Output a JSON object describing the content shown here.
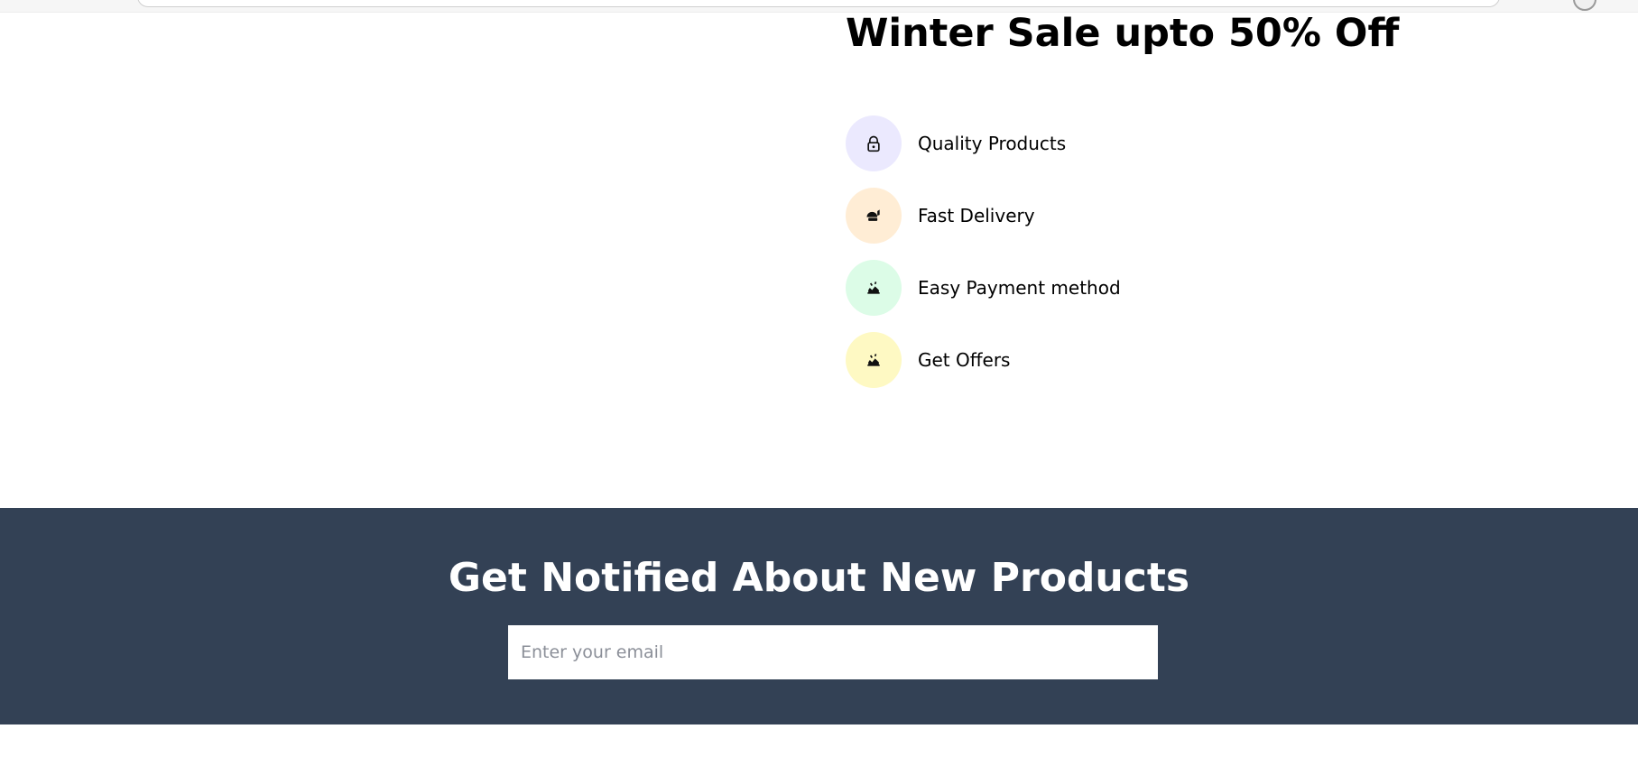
{
  "sale": {
    "title": "Winter Sale upto 50% Off",
    "features": [
      {
        "label": "Quality Products",
        "icon": "lock-icon",
        "bg": "#ebe9fe"
      },
      {
        "label": "Fast Delivery",
        "icon": "delivery-icon",
        "bg": "#ffedd5"
      },
      {
        "label": "Easy Payment method",
        "icon": "payment-icon",
        "bg": "#dcfce7"
      },
      {
        "label": "Get Offers",
        "icon": "offers-icon",
        "bg": "#fef9c3"
      }
    ]
  },
  "newsletter": {
    "title": "Get Notified About New Products",
    "email_placeholder": "Enter your email",
    "bg": "#334155"
  }
}
